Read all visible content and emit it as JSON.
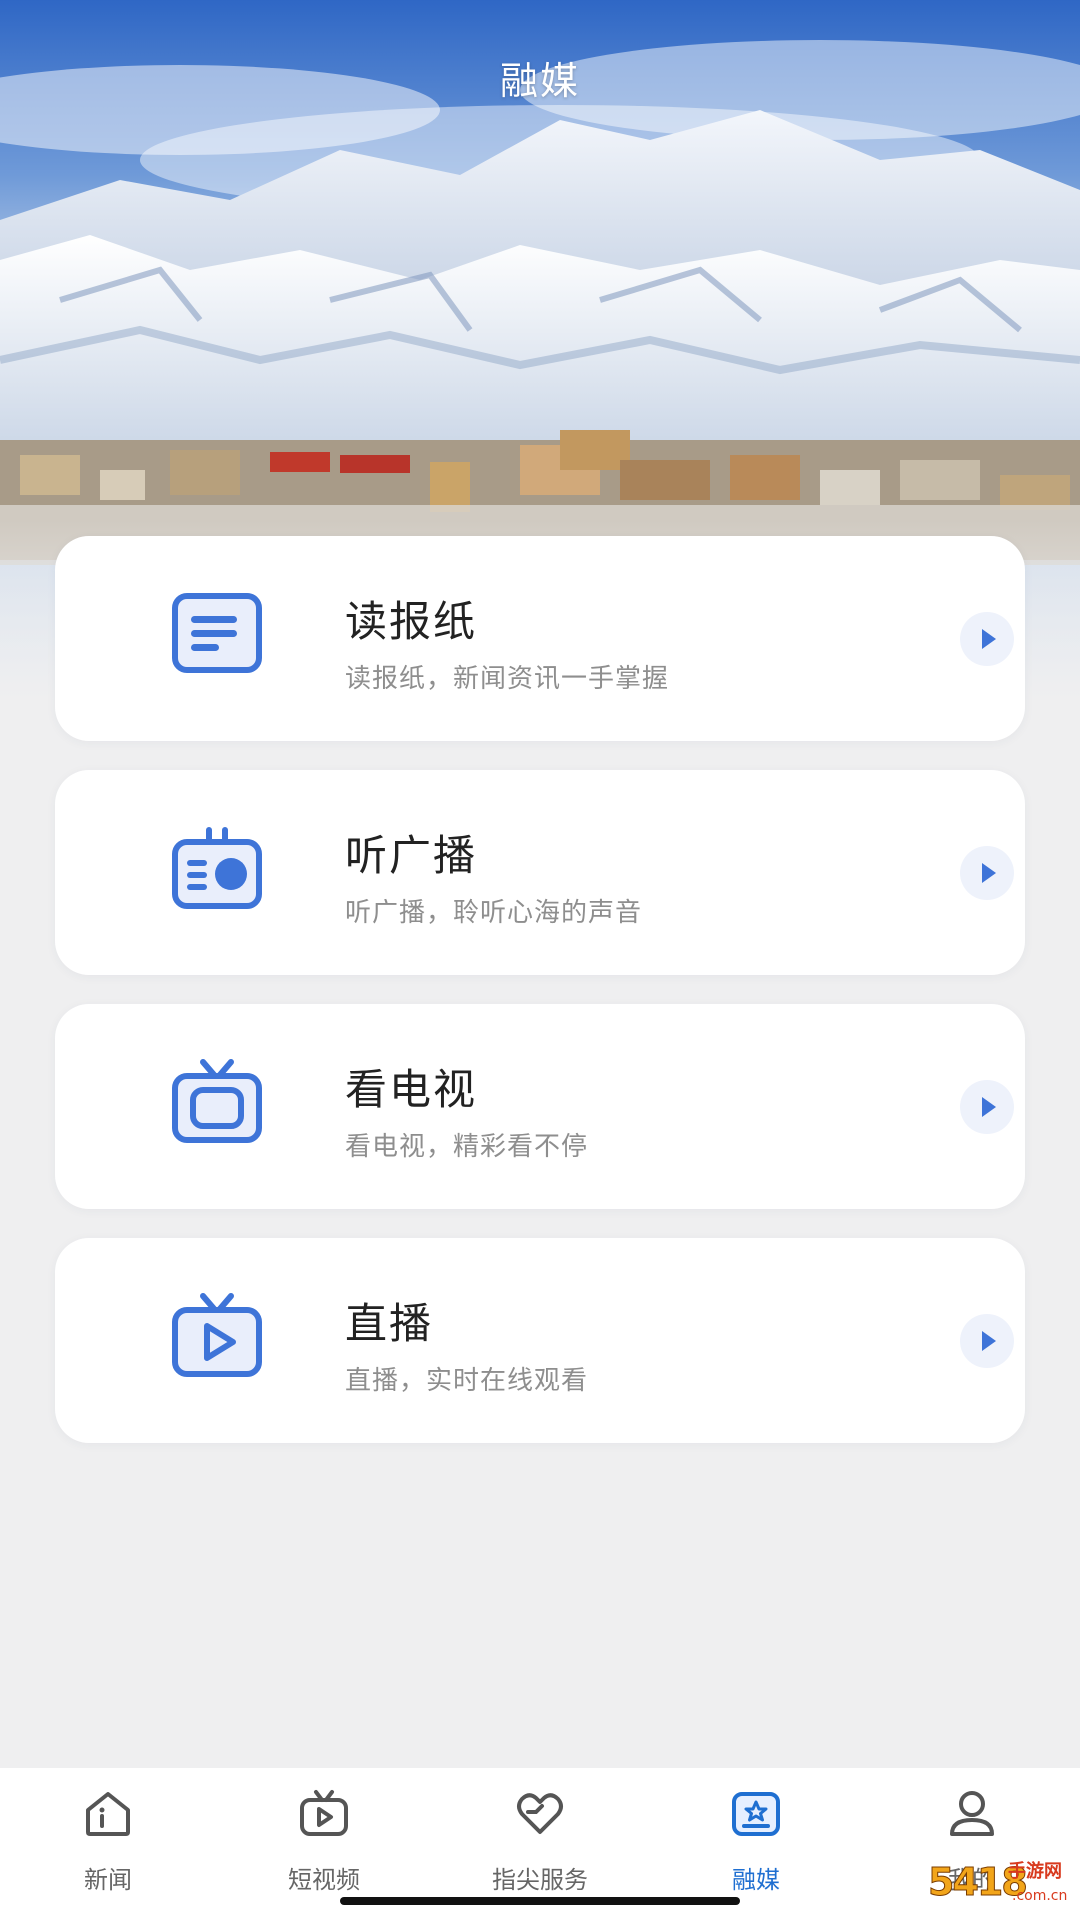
{
  "header": {
    "title": "融媒"
  },
  "cards": [
    {
      "title": "读报纸",
      "subtitle": "读报纸，新闻资讯一手掌握",
      "icon": "newspaper-icon"
    },
    {
      "title": "听广播",
      "subtitle": "听广播，聆听心海的声音",
      "icon": "radio-icon"
    },
    {
      "title": "看电视",
      "subtitle": "看电视，精彩看不停",
      "icon": "tv-icon"
    },
    {
      "title": "直播",
      "subtitle": "直播，实时在线观看",
      "icon": "live-tv-icon"
    }
  ],
  "tabbar": {
    "items": [
      {
        "label": "新闻",
        "icon": "home-icon",
        "active": false
      },
      {
        "label": "短视频",
        "icon": "video-icon",
        "active": false
      },
      {
        "label": "指尖服务",
        "icon": "heart-icon",
        "active": false
      },
      {
        "label": "融媒",
        "icon": "media-icon",
        "active": true
      },
      {
        "label": "我的",
        "icon": "profile-icon",
        "active": false
      }
    ]
  },
  "watermark": {
    "main": "5418",
    "sub": "手游网",
    "domain": ".com.cn"
  },
  "colors": {
    "accent": "#3e74d8",
    "active_tab": "#1f6fd1",
    "background": "#efeff0",
    "card": "#ffffff"
  }
}
